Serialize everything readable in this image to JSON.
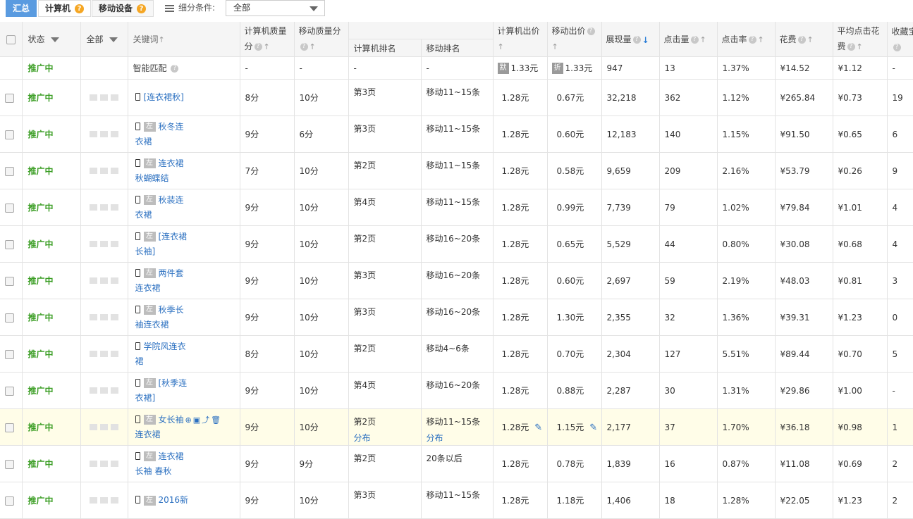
{
  "tabs": {
    "summary": "汇总",
    "computer": "计算机",
    "mobile": "移动设备",
    "help": "?"
  },
  "filter": {
    "label": "细分条件:",
    "value": "全部"
  },
  "headers": {
    "status": "状态",
    "all": "全部",
    "keyword": "关键词",
    "pc_quality_1": "计算机质量",
    "pc_quality_2": "分",
    "mobile_quality": "移动质量分",
    "pc_rank": "计算机排名",
    "mobile_rank": "移动排名",
    "pc_bid": "计算机出价",
    "mobile_bid": "移动出价",
    "impressions": "展现量",
    "clicks": "点击量",
    "ctr": "点击率",
    "cost": "花费",
    "avg_cpc_1": "平均点击花",
    "avg_cpc_2": "费",
    "favorites": "收藏宝"
  },
  "smart_row": {
    "status": "推广中",
    "keyword": "智能匹配",
    "pc_quality": "-",
    "mobile_quality": "-",
    "pc_rank": "-",
    "mobile_rank": "-",
    "pc_tag": "默",
    "pc_bid": "1.33元",
    "mobile_tag": "折",
    "mobile_bid": "1.33元",
    "impressions": "947",
    "clicks": "13",
    "ctr": "1.37%",
    "cost": "¥14.52",
    "avg_cpc": "¥1.12",
    "favorites": "-"
  },
  "rows": [
    {
      "status": "推广中",
      "left": false,
      "kw1": "[连衣裙秋]",
      "kw2": "",
      "pc_quality": "8分",
      "mobile_quality": "10分",
      "pc_rank": "第3页",
      "mobile_rank": "移动11~15条",
      "pc_bid": "1.28元",
      "mobile_bid": "0.67元",
      "impressions": "32,218",
      "clicks": "362",
      "ctr": "1.12%",
      "cost": "¥265.84",
      "avg_cpc": "¥0.73",
      "favorites": "19"
    },
    {
      "status": "推广中",
      "left": true,
      "kw1": "秋冬连",
      "kw2": "衣裙",
      "pc_quality": "9分",
      "mobile_quality": "6分",
      "pc_rank": "第3页",
      "mobile_rank": "移动11~15条",
      "pc_bid": "1.28元",
      "mobile_bid": "0.60元",
      "impressions": "12,183",
      "clicks": "140",
      "ctr": "1.15%",
      "cost": "¥91.50",
      "avg_cpc": "¥0.65",
      "favorites": "6"
    },
    {
      "status": "推广中",
      "left": true,
      "kw1": "连衣裙",
      "kw2": "秋蝴蝶结",
      "pc_quality": "7分",
      "mobile_quality": "10分",
      "pc_rank": "第2页",
      "mobile_rank": "移动11~15条",
      "pc_bid": "1.28元",
      "mobile_bid": "0.58元",
      "impressions": "9,659",
      "clicks": "209",
      "ctr": "2.16%",
      "cost": "¥53.79",
      "avg_cpc": "¥0.26",
      "favorites": "9"
    },
    {
      "status": "推广中",
      "left": true,
      "kw1": "秋装连",
      "kw2": "衣裙",
      "pc_quality": "9分",
      "mobile_quality": "10分",
      "pc_rank": "第4页",
      "mobile_rank": "移动11~15条",
      "pc_bid": "1.28元",
      "mobile_bid": "0.99元",
      "impressions": "7,739",
      "clicks": "79",
      "ctr": "1.02%",
      "cost": "¥79.84",
      "avg_cpc": "¥1.01",
      "favorites": "4"
    },
    {
      "status": "推广中",
      "left": true,
      "kw1": "[连衣裙",
      "kw2": "长袖]",
      "pc_quality": "9分",
      "mobile_quality": "10分",
      "pc_rank": "第2页",
      "mobile_rank": "移动16~20条",
      "pc_bid": "1.28元",
      "mobile_bid": "0.65元",
      "impressions": "5,529",
      "clicks": "44",
      "ctr": "0.80%",
      "cost": "¥30.08",
      "avg_cpc": "¥0.68",
      "favorites": "4"
    },
    {
      "status": "推广中",
      "left": true,
      "kw1": "两件套",
      "kw2": "连衣裙",
      "pc_quality": "9分",
      "mobile_quality": "10分",
      "pc_rank": "第3页",
      "mobile_rank": "移动16~20条",
      "pc_bid": "1.28元",
      "mobile_bid": "0.60元",
      "impressions": "2,697",
      "clicks": "59",
      "ctr": "2.19%",
      "cost": "¥48.03",
      "avg_cpc": "¥0.81",
      "favorites": "3"
    },
    {
      "status": "推广中",
      "left": true,
      "kw1": "秋季长",
      "kw2": "袖连衣裙",
      "pc_quality": "9分",
      "mobile_quality": "10分",
      "pc_rank": "第3页",
      "mobile_rank": "移动16~20条",
      "pc_bid": "1.28元",
      "mobile_bid": "1.30元",
      "impressions": "2,355",
      "clicks": "32",
      "ctr": "1.36%",
      "cost": "¥39.31",
      "avg_cpc": "¥1.23",
      "favorites": "0"
    },
    {
      "status": "推广中",
      "left": false,
      "kw1": "学院风连衣",
      "kw2": "裙",
      "pc_quality": "8分",
      "mobile_quality": "10分",
      "pc_rank": "第2页",
      "mobile_rank": "移动4~6条",
      "pc_bid": "1.28元",
      "mobile_bid": "0.70元",
      "impressions": "2,304",
      "clicks": "127",
      "ctr": "5.51%",
      "cost": "¥89.44",
      "avg_cpc": "¥0.70",
      "favorites": "5"
    },
    {
      "status": "推广中",
      "left": true,
      "kw1": "[秋季连",
      "kw2": "衣裙]",
      "pc_quality": "9分",
      "mobile_quality": "10分",
      "pc_rank": "第4页",
      "mobile_rank": "移动16~20条",
      "pc_bid": "1.28元",
      "mobile_bid": "0.88元",
      "impressions": "2,287",
      "clicks": "30",
      "ctr": "1.31%",
      "cost": "¥29.86",
      "avg_cpc": "¥1.00",
      "favorites": "-"
    },
    {
      "status": "推广中",
      "left": true,
      "kw1": "女长袖",
      "kw2": "连衣裙",
      "pc_quality": "9分",
      "mobile_quality": "10分",
      "pc_rank": "第2页",
      "pc_rank2": "分布",
      "mobile_rank": "移动11~15条",
      "mobile_rank2": "分布",
      "pc_bid": "1.28元",
      "mobile_bid": "1.15元",
      "impressions": "2,177",
      "clicks": "37",
      "ctr": "1.70%",
      "cost": "¥36.18",
      "avg_cpc": "¥0.98",
      "favorites": "1"
    },
    {
      "status": "推广中",
      "left": true,
      "kw1": "连衣裙",
      "kw2": "长袖 春秋",
      "pc_quality": "9分",
      "mobile_quality": "9分",
      "pc_rank": "第2页",
      "mobile_rank": "20条以后",
      "pc_bid": "1.28元",
      "mobile_bid": "0.78元",
      "impressions": "1,839",
      "clicks": "16",
      "ctr": "0.87%",
      "cost": "¥11.08",
      "avg_cpc": "¥0.69",
      "favorites": "2"
    },
    {
      "status": "推广中",
      "left": true,
      "kw1": "2016新",
      "kw2": "",
      "pc_quality": "9分",
      "mobile_quality": "10分",
      "pc_rank": "第3页",
      "mobile_rank": "移动11~15条",
      "pc_bid": "1.28元",
      "mobile_bid": "1.18元",
      "impressions": "1,406",
      "clicks": "18",
      "ctr": "1.28%",
      "cost": "¥22.05",
      "avg_cpc": "¥1.23",
      "favorites": "2"
    }
  ],
  "row_left_tag": "左"
}
